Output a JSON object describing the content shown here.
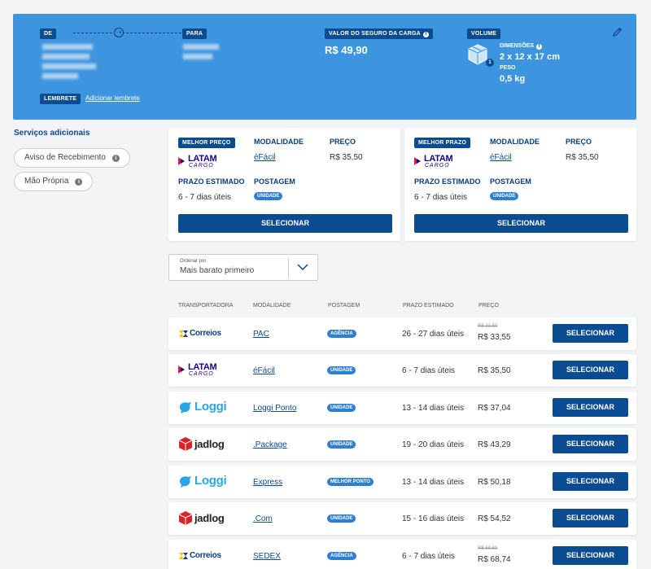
{
  "header": {
    "from_label": "DE",
    "to_label": "PARA",
    "insurance_label": "VALOR DO SEGURO DA CARGA",
    "insurance_value": "R$ 49,90",
    "volume_label": "VOLUME",
    "volume_badge": "1",
    "dimensions_label": "DIMENSÕES",
    "dimensions_value": "2 x 12 x 17 cm",
    "weight_label": "PESO",
    "weight_value": "0,5 kg",
    "reminder_label": "LEMBRETE",
    "add_reminder_link": "Adicionar lembrete",
    "icons": {
      "edit": "pencil-icon",
      "box": "package-icon",
      "info": "info-icon",
      "arrow": "arrow-right-icon"
    }
  },
  "sidebar": {
    "title": "Serviços adicionais",
    "options": [
      {
        "label": "Aviso de Recebimento"
      },
      {
        "label": "Mão Própria"
      }
    ]
  },
  "best_cards": [
    {
      "badge": "MELHOR PREÇO",
      "carrier": {
        "line1": "LATAM",
        "line2": "CARGO"
      },
      "modality_label": "MODALIDADE",
      "modality": "éFácil",
      "price_label": "PREÇO",
      "price": "R$ 35,50",
      "deadline_label": "PRAZO ESTIMADO",
      "deadline": "6 - 7 dias úteis",
      "posting_label": "POSTAGEM",
      "posting": "UNIDADE",
      "button": "SELECIONAR"
    },
    {
      "badge": "MELHOR PRAZO",
      "carrier": {
        "line1": "LATAM",
        "line2": "CARGO"
      },
      "modality_label": "MODALIDADE",
      "modality": "éFácil",
      "price_label": "PREÇO",
      "price": "R$ 35,50",
      "deadline_label": "PRAZO ESTIMADO",
      "deadline": "6 - 7 dias úteis",
      "posting_label": "POSTAGEM",
      "posting": "UNIDADE",
      "button": "SELECIONAR"
    }
  ],
  "sort": {
    "label": "Ordenar por",
    "value": "Mais barato primeiro"
  },
  "table": {
    "headers": [
      "TRANSPORTADORA",
      "MODALIDADE",
      "POSTAGEM",
      "PRAZO ESTIMADO",
      "PREÇO"
    ],
    "rows": [
      {
        "carrier": "Correios",
        "modality": "PAC",
        "posting": "AGÊNCIA",
        "deadline": "26 - 27 dias úteis",
        "old_price": "R$ 33,50",
        "price": "R$ 33,55",
        "button": "SELECIONAR"
      },
      {
        "carrier": "LATAM",
        "carrier_sub": "CARGO",
        "modality": "éFácil",
        "posting": "UNIDADE",
        "deadline": "6 - 7 dias úteis",
        "price": "R$ 35,50",
        "button": "SELECIONAR"
      },
      {
        "carrier": "Loggi",
        "modality": "Loggi Ponto",
        "posting": "UNIDADE",
        "deadline": "13 - 14 dias úteis",
        "price": "R$ 37,04",
        "button": "SELECIONAR"
      },
      {
        "carrier": "jadlog",
        "modality": ".Package",
        "posting": "UNIDADE",
        "deadline": "19 - 20 dias úteis",
        "price": "R$ 43,29",
        "button": "SELECIONAR"
      },
      {
        "carrier": "Loggi",
        "modality": "Express",
        "posting": "MELHOR PONTO",
        "deadline": "13 - 14 dias úteis",
        "price": "R$ 50,18",
        "button": "SELECIONAR"
      },
      {
        "carrier": "jadlog",
        "modality": ".Com",
        "posting": "UNIDADE",
        "deadline": "15 - 16 dias úteis",
        "price": "R$ 54,52",
        "button": "SELECIONAR"
      },
      {
        "carrier": "Correios",
        "modality": "SEDEX",
        "posting": "AGÊNCIA",
        "deadline": "6 - 7 dias úteis",
        "old_price": "R$ 68,69",
        "price": "R$ 68,74",
        "button": "SELECIONAR"
      }
    ]
  },
  "colors": {
    "header_bg": "#3d95e0",
    "primary": "#0b4b91",
    "tag": "#2f7fd1",
    "latam": "#1b0088",
    "loggi": "#2aa6e8",
    "jadlog_red": "#d9232a"
  }
}
